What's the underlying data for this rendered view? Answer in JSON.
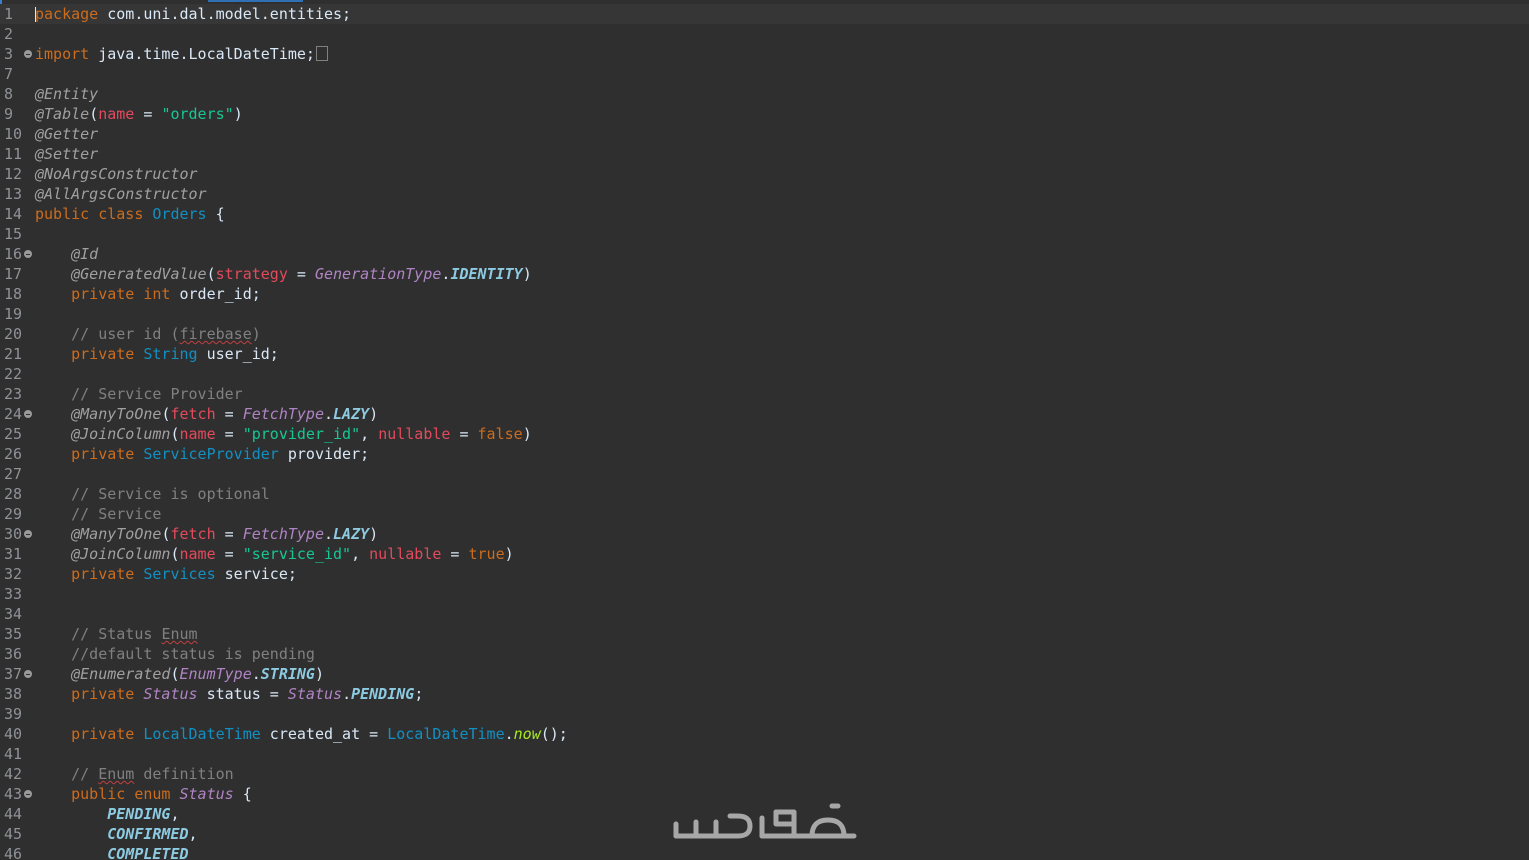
{
  "editor": {
    "colors": {
      "background": "#2f2f2f",
      "keyword": "#cc6c1d",
      "annotation": "#a0a0a0",
      "attribute": "#e34b5c",
      "string": "#17c694",
      "type": "#1290c3",
      "comment": "#808080"
    },
    "lines": [
      {
        "n": "1",
        "t": [
          [
            "kw",
            "package"
          ],
          [
            "plain",
            " com.uni.dal.model.entities;"
          ]
        ]
      },
      {
        "n": "2",
        "t": []
      },
      {
        "n": "3",
        "t": [
          [
            "kw",
            "import"
          ],
          [
            "plain",
            " java.time.LocalDateTime;"
          ]
        ]
      },
      {
        "n": "7",
        "t": []
      },
      {
        "n": "8",
        "t": [
          [
            "ann",
            "@Entity"
          ]
        ]
      },
      {
        "n": "9",
        "t": [
          [
            "ann",
            "@Table"
          ],
          [
            "plain",
            "("
          ],
          [
            "attr",
            "name"
          ],
          [
            "plain",
            " = "
          ],
          [
            "str",
            "\"orders\""
          ],
          [
            "plain",
            ")"
          ]
        ]
      },
      {
        "n": "10",
        "t": [
          [
            "ann",
            "@Getter"
          ]
        ]
      },
      {
        "n": "11",
        "t": [
          [
            "ann",
            "@Setter"
          ]
        ]
      },
      {
        "n": "12",
        "t": [
          [
            "ann",
            "@NoArgsConstructor"
          ]
        ]
      },
      {
        "n": "13",
        "t": [
          [
            "ann",
            "@AllArgsConstructor"
          ]
        ]
      },
      {
        "n": "14",
        "t": [
          [
            "kw",
            "public"
          ],
          [
            "plain",
            " "
          ],
          [
            "kw",
            "class"
          ],
          [
            "plain",
            " "
          ],
          [
            "type",
            "Orders"
          ],
          [
            "plain",
            " {"
          ]
        ]
      },
      {
        "n": "15",
        "t": []
      },
      {
        "n": "16",
        "t": [
          [
            "plain",
            "    "
          ],
          [
            "ann",
            "@Id"
          ]
        ]
      },
      {
        "n": "17",
        "t": [
          [
            "plain",
            "    "
          ],
          [
            "ann",
            "@GeneratedValue"
          ],
          [
            "plain",
            "("
          ],
          [
            "attr",
            "strategy"
          ],
          [
            "plain",
            " = "
          ],
          [
            "itype",
            "GenerationType"
          ],
          [
            "plain",
            "."
          ],
          [
            "enumc",
            "IDENTITY"
          ],
          [
            "plain",
            ")"
          ]
        ]
      },
      {
        "n": "18",
        "t": [
          [
            "plain",
            "    "
          ],
          [
            "kw",
            "private"
          ],
          [
            "plain",
            " "
          ],
          [
            "kw",
            "int"
          ],
          [
            "plain",
            " order_id;"
          ]
        ]
      },
      {
        "n": "19",
        "t": []
      },
      {
        "n": "20",
        "t": [
          [
            "plain",
            "    "
          ],
          [
            "cmt",
            "// user id ("
          ],
          [
            "cmtsq",
            "firebase"
          ],
          [
            "cmt",
            ")"
          ]
        ]
      },
      {
        "n": "21",
        "t": [
          [
            "plain",
            "    "
          ],
          [
            "kw",
            "private"
          ],
          [
            "plain",
            " "
          ],
          [
            "type",
            "String"
          ],
          [
            "plain",
            " user_id;"
          ]
        ]
      },
      {
        "n": "22",
        "t": []
      },
      {
        "n": "23",
        "t": [
          [
            "plain",
            "    "
          ],
          [
            "cmt",
            "// Service Provider"
          ]
        ]
      },
      {
        "n": "24",
        "t": [
          [
            "plain",
            "    "
          ],
          [
            "ann",
            "@ManyToOne"
          ],
          [
            "plain",
            "("
          ],
          [
            "attr",
            "fetch"
          ],
          [
            "plain",
            " = "
          ],
          [
            "itype",
            "FetchType"
          ],
          [
            "plain",
            "."
          ],
          [
            "enumc",
            "LAZY"
          ],
          [
            "plain",
            ")"
          ]
        ]
      },
      {
        "n": "25",
        "t": [
          [
            "plain",
            "    "
          ],
          [
            "ann",
            "@JoinColumn"
          ],
          [
            "plain",
            "("
          ],
          [
            "attr",
            "name"
          ],
          [
            "plain",
            " = "
          ],
          [
            "str",
            "\"provider_id\""
          ],
          [
            "plain",
            ", "
          ],
          [
            "attr",
            "nullable"
          ],
          [
            "plain",
            " = "
          ],
          [
            "kw",
            "false"
          ],
          [
            "plain",
            ")"
          ]
        ]
      },
      {
        "n": "26",
        "t": [
          [
            "plain",
            "    "
          ],
          [
            "kw",
            "private"
          ],
          [
            "plain",
            " "
          ],
          [
            "type",
            "ServiceProvider"
          ],
          [
            "plain",
            " provider;"
          ]
        ]
      },
      {
        "n": "27",
        "t": []
      },
      {
        "n": "28",
        "t": [
          [
            "plain",
            "    "
          ],
          [
            "cmt",
            "// Service is optional"
          ]
        ]
      },
      {
        "n": "29",
        "t": [
          [
            "plain",
            "    "
          ],
          [
            "cmt",
            "// Service"
          ]
        ]
      },
      {
        "n": "30",
        "t": [
          [
            "plain",
            "    "
          ],
          [
            "ann",
            "@ManyToOne"
          ],
          [
            "plain",
            "("
          ],
          [
            "attr",
            "fetch"
          ],
          [
            "plain",
            " = "
          ],
          [
            "itype",
            "FetchType"
          ],
          [
            "plain",
            "."
          ],
          [
            "enumc",
            "LAZY"
          ],
          [
            "plain",
            ")"
          ]
        ]
      },
      {
        "n": "31",
        "t": [
          [
            "plain",
            "    "
          ],
          [
            "ann",
            "@JoinColumn"
          ],
          [
            "plain",
            "("
          ],
          [
            "attr",
            "name"
          ],
          [
            "plain",
            " = "
          ],
          [
            "str",
            "\"service_id\""
          ],
          [
            "plain",
            ", "
          ],
          [
            "attr",
            "nullable"
          ],
          [
            "plain",
            " = "
          ],
          [
            "kw",
            "true"
          ],
          [
            "plain",
            ")"
          ]
        ]
      },
      {
        "n": "32",
        "t": [
          [
            "plain",
            "    "
          ],
          [
            "kw",
            "private"
          ],
          [
            "plain",
            " "
          ],
          [
            "type",
            "Services"
          ],
          [
            "plain",
            " service;"
          ]
        ]
      },
      {
        "n": "33",
        "t": []
      },
      {
        "n": "34",
        "t": []
      },
      {
        "n": "35",
        "t": [
          [
            "plain",
            "    "
          ],
          [
            "cmt",
            "// Status "
          ],
          [
            "cmtsq",
            "Enum"
          ]
        ]
      },
      {
        "n": "36",
        "t": [
          [
            "plain",
            "    "
          ],
          [
            "cmt",
            "//default status is pending"
          ]
        ]
      },
      {
        "n": "37",
        "t": [
          [
            "plain",
            "    "
          ],
          [
            "ann",
            "@Enumerated"
          ],
          [
            "plain",
            "("
          ],
          [
            "itype",
            "EnumType"
          ],
          [
            "plain",
            "."
          ],
          [
            "enumc",
            "STRING"
          ],
          [
            "plain",
            ")"
          ]
        ]
      },
      {
        "n": "38",
        "t": [
          [
            "plain",
            "    "
          ],
          [
            "kw",
            "private"
          ],
          [
            "plain",
            " "
          ],
          [
            "itype",
            "Status"
          ],
          [
            "plain",
            " status = "
          ],
          [
            "itype",
            "Status"
          ],
          [
            "plain",
            "."
          ],
          [
            "enumc",
            "PENDING"
          ],
          [
            "plain",
            ";"
          ]
        ]
      },
      {
        "n": "39",
        "t": []
      },
      {
        "n": "40",
        "t": [
          [
            "plain",
            "    "
          ],
          [
            "kw",
            "private"
          ],
          [
            "plain",
            " "
          ],
          [
            "type",
            "LocalDateTime"
          ],
          [
            "plain",
            " created_at = "
          ],
          [
            "type",
            "LocalDateTime"
          ],
          [
            "plain",
            "."
          ],
          [
            "meth",
            "now"
          ],
          [
            "plain",
            "();"
          ]
        ]
      },
      {
        "n": "41",
        "t": []
      },
      {
        "n": "42",
        "t": [
          [
            "plain",
            "    "
          ],
          [
            "cmt",
            "// "
          ],
          [
            "cmtsq",
            "Enum"
          ],
          [
            "cmt",
            " definition"
          ]
        ]
      },
      {
        "n": "43",
        "t": [
          [
            "plain",
            "    "
          ],
          [
            "kw",
            "public"
          ],
          [
            "plain",
            " "
          ],
          [
            "kw",
            "enum"
          ],
          [
            "plain",
            " "
          ],
          [
            "itype",
            "Status"
          ],
          [
            "plain",
            " {"
          ]
        ]
      },
      {
        "n": "44",
        "t": [
          [
            "plain",
            "        "
          ],
          [
            "enumc",
            "PENDING"
          ],
          [
            "plain",
            ","
          ]
        ]
      },
      {
        "n": "45",
        "t": [
          [
            "plain",
            "        "
          ],
          [
            "enumc",
            "CONFIRMED"
          ],
          [
            "plain",
            ","
          ]
        ]
      },
      {
        "n": "46",
        "t": [
          [
            "plain",
            "        "
          ],
          [
            "enumc",
            "COMPLETED"
          ]
        ]
      }
    ],
    "fold_markers": [
      "3",
      "16",
      "24",
      "30",
      "37",
      "43"
    ],
    "collapsed_lines": [
      "3"
    ],
    "current_line": "1"
  },
  "watermark": {
    "logo_text": "خمسات"
  }
}
